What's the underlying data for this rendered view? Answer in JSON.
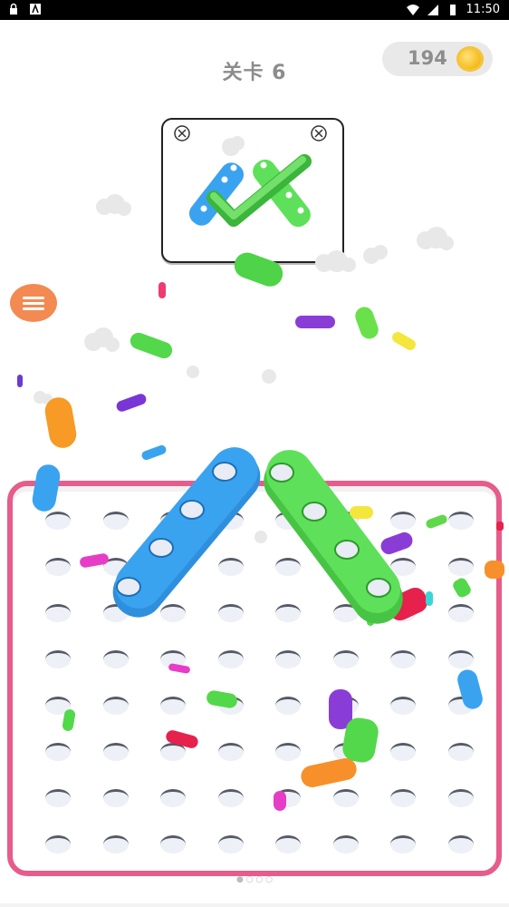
{
  "status_bar": {
    "time": "11:50"
  },
  "level": {
    "title": "关卡 6"
  },
  "coins": {
    "value": "194"
  },
  "board": {
    "rows": 8,
    "cols": 8,
    "frame_color": "#e65c8a"
  },
  "pieces": [
    {
      "name": "blue-bar",
      "color": "#3aa3f0"
    },
    {
      "name": "green-bar",
      "color": "#5ee05a"
    }
  ],
  "icons": {
    "menu": "hamburger-menu-icon",
    "coin": "coin-icon",
    "checkmark": "checkmark-icon",
    "screw": "screw-icon"
  }
}
